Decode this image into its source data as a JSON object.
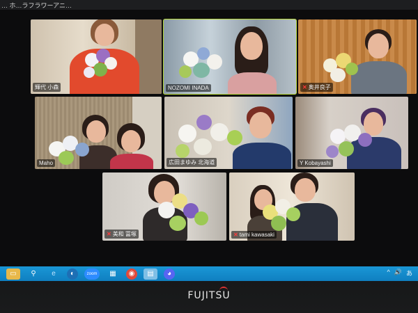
{
  "window": {
    "meeting_title": "… ホ…ラフラワーアニ…"
  },
  "participants": [
    {
      "name": "輝代 小森",
      "muted": false,
      "active": false
    },
    {
      "name": "NOZOMI INADA",
      "muted": false,
      "active": true
    },
    {
      "name": "奥井良子",
      "muted": true,
      "active": false
    },
    {
      "name": "Maho",
      "muted": false,
      "active": false
    },
    {
      "name": "広田まゆみ 北海道",
      "muted": false,
      "active": false
    },
    {
      "name": "Y Kobayashi",
      "muted": false,
      "active": false
    },
    {
      "name": "美和 冨塚",
      "muted": true,
      "active": false
    },
    {
      "name": "tami kawasaki",
      "muted": true,
      "active": false
    }
  ],
  "taskbar": {
    "icons": [
      "file-explorer-icon",
      "search-icon",
      "internet-explorer-icon",
      "edge-icon",
      "zoom-icon",
      "task-view-icon",
      "chrome-icon",
      "notes-icon",
      "discord-icon"
    ],
    "zoom_label": "zoom",
    "tray": {
      "expand": "^",
      "volume": "🔊",
      "ime": "あ"
    }
  },
  "device": {
    "brand": "FUJITSU"
  },
  "colors": {
    "active_speaker_outline": "#b7d83a",
    "mute_icon": "#ff3b3b",
    "taskbar": "#1a97d6"
  }
}
